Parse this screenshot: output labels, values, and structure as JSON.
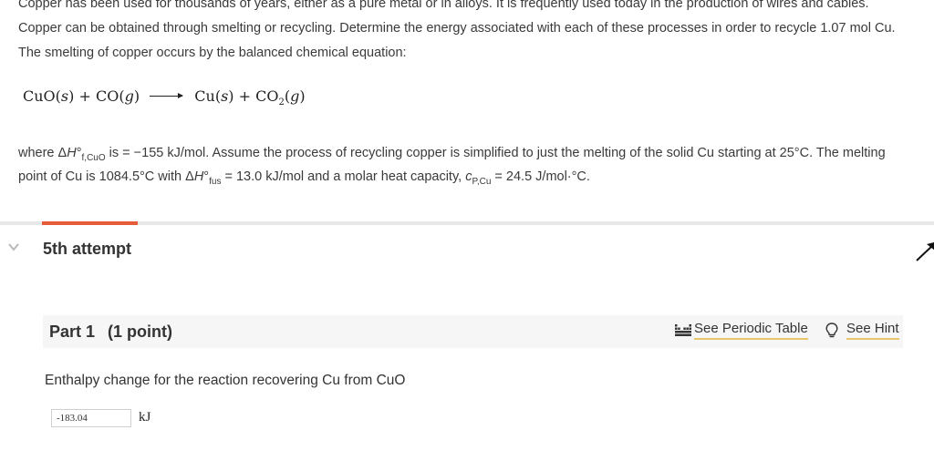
{
  "problem": {
    "line1": "Copper has been used for thousands of years, either as a pure metal or in alloys. It is frequently used today in the production of wires and cables.",
    "line2": "Copper can be obtained through smelting or recycling. Determine the energy associated with each of these processes in order to recycle 1.07 mol Cu.",
    "line3": "The smelting of copper occurs by the balanced chemical equation:",
    "equation": {
      "r1_formula": "CuO",
      "r1_state": "s",
      "plus": "+",
      "r2_formula": "CO",
      "r2_state": "g",
      "p1_formula": "Cu",
      "p1_state": "s",
      "p2_formula": "CO",
      "p2_sub": "2",
      "p2_state": "g"
    },
    "line4": {
      "pre": "where Δ",
      "H": "H",
      "deg": "°",
      "sub": "f,CuO",
      "post": " is = −155 kJ/mol. Assume the process of recycling copper is simplified to just the melting of the solid Cu starting at 25°C. The melting"
    },
    "line5": {
      "pre": "point of Cu is 1084.5°C with Δ",
      "H": "H",
      "deg": "°",
      "sub": "fus",
      "mid": " = 13.0 kJ/mol and a molar heat capacity, ",
      "c": "c",
      "csub": "P,Cu",
      "post": " = 24.5 J/mol·°C."
    }
  },
  "attempt": {
    "label": "5th attempt"
  },
  "part": {
    "title": "Part 1",
    "points": "(1 point)",
    "periodic_label": "See Periodic Table",
    "hint_label": "See Hint"
  },
  "question": {
    "text": "Enthalpy change for the reaction recovering Cu from CuO",
    "answer_value": "-183.04",
    "unit": "kJ"
  },
  "colors": {
    "accent": "#e65c3a",
    "link_underline": "#e8c46a",
    "chevron": "#b8b8b8"
  },
  "icons": [
    "chevron-down-icon",
    "periodic-table-icon",
    "lightbulb-icon",
    "arrow-icon"
  ]
}
